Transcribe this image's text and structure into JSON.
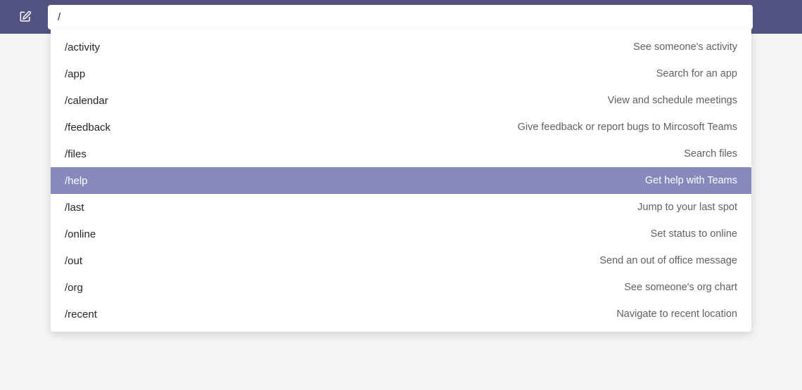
{
  "search": {
    "value": "/"
  },
  "commands": [
    {
      "cmd": "/activity",
      "desc": "See someone's activity",
      "highlighted": false
    },
    {
      "cmd": "/app",
      "desc": "Search for an app",
      "highlighted": false
    },
    {
      "cmd": "/calendar",
      "desc": "View and schedule meetings",
      "highlighted": false
    },
    {
      "cmd": "/feedback",
      "desc": "Give feedback or report bugs to Mircosoft Teams",
      "highlighted": false
    },
    {
      "cmd": "/files",
      "desc": "Search files",
      "highlighted": false
    },
    {
      "cmd": "/help",
      "desc": "Get help with Teams",
      "highlighted": true
    },
    {
      "cmd": "/last",
      "desc": "Jump to your last spot",
      "highlighted": false
    },
    {
      "cmd": "/online",
      "desc": "Set status to online",
      "highlighted": false
    },
    {
      "cmd": "/out",
      "desc": "Send an out of office message",
      "highlighted": false
    },
    {
      "cmd": "/org",
      "desc": "See someone's org chart",
      "highlighted": false
    },
    {
      "cmd": "/recent",
      "desc": "Navigate to recent location",
      "highlighted": false
    }
  ]
}
